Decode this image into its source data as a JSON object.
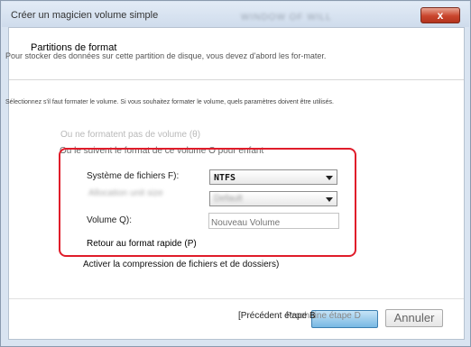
{
  "window": {
    "title": "Créer un magicien volume simple",
    "blurred_header": "WINDOW OF WILL",
    "close_label": "x"
  },
  "header": {
    "title": "Partitions de format",
    "description": "Pour stocker des données sur cette partition de disque, vous devez d'abord les for-mater."
  },
  "instruction": "Sélectionnez s'il faut formater le volume. Si vous souhaitez formater le volume, quels paramètres doivent être utilisés.",
  "options": {
    "dont_format": "Ou ne formatent pas de volume (θ)",
    "format_following": "Ou le suivent le format de ce volume O pour enfant"
  },
  "form": {
    "filesystem_label": "Système de fichiers F):",
    "filesystem_value": "NTFS",
    "allocation_label": "Allocation unit size",
    "allocation_value": "Default",
    "volume_label": "Volume Q):",
    "volume_placeholder": "Nouveau Volume",
    "quick_format": "Retour au format rapide (P)",
    "compression": "Activer la compression de fichiers et de dossiers)"
  },
  "footer": {
    "back_label": "[Précédent étape B",
    "next_label": "Prochaine étape D",
    "cancel_label": "Annuler"
  }
}
